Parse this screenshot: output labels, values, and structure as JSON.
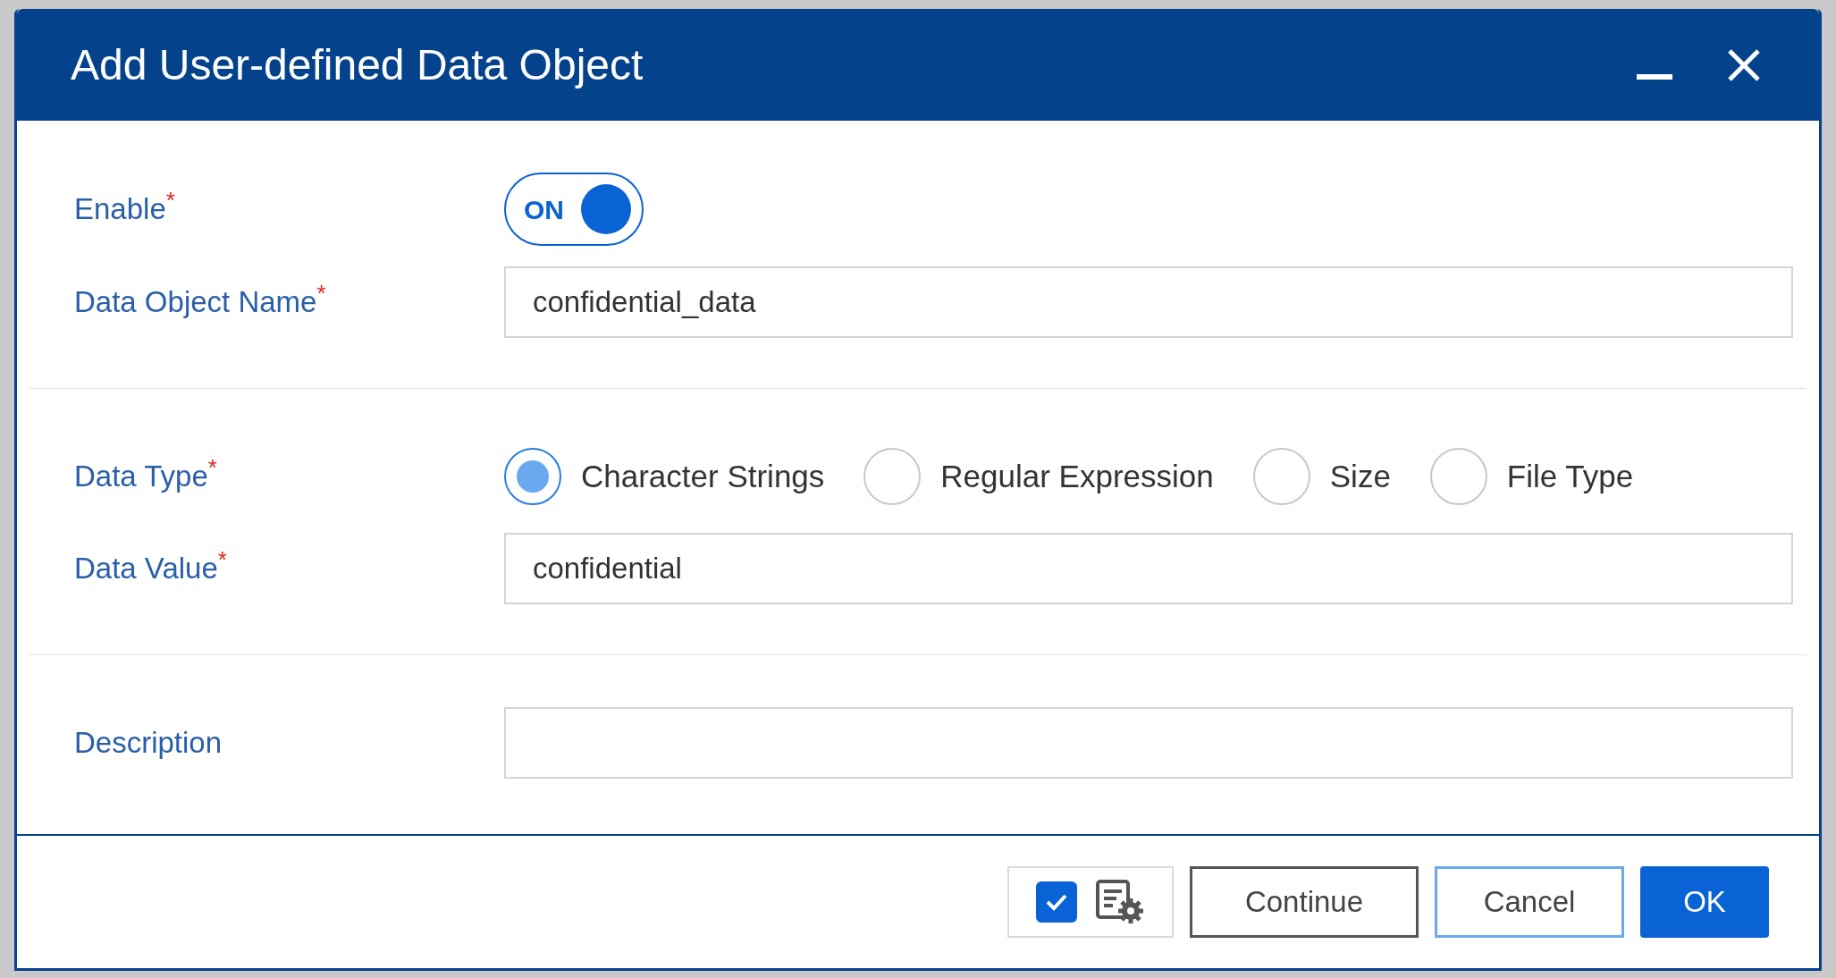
{
  "window": {
    "title": "Add User-defined Data Object"
  },
  "sections": [
    {
      "fields": [
        {
          "kind": "toggle",
          "label": "Enable",
          "required_mark": "*",
          "on": true,
          "toggle_text": "ON"
        },
        {
          "kind": "text",
          "label": "Data Object Name",
          "required_mark": "*",
          "value": "confidential_data"
        }
      ]
    },
    {
      "fields": [
        {
          "kind": "radio",
          "label": "Data Type",
          "required_mark": "*",
          "options": [
            {
              "label": "Character Strings",
              "selected": true
            },
            {
              "label": "Regular Expression",
              "selected": false
            },
            {
              "label": "Size",
              "selected": false
            },
            {
              "label": "File Type",
              "selected": false
            }
          ]
        },
        {
          "kind": "text",
          "label": "Data Value",
          "required_mark": "*",
          "value": "confidential"
        }
      ]
    },
    {
      "fields": [
        {
          "kind": "text",
          "label": "Description"
        }
      ]
    }
  ],
  "footer": {
    "checkbox_checked": true,
    "buttons": [
      {
        "label": "Continue",
        "kind": "secondary"
      },
      {
        "label": "Cancel",
        "kind": "outline"
      },
      {
        "label": "OK",
        "kind": "primary"
      }
    ]
  }
}
